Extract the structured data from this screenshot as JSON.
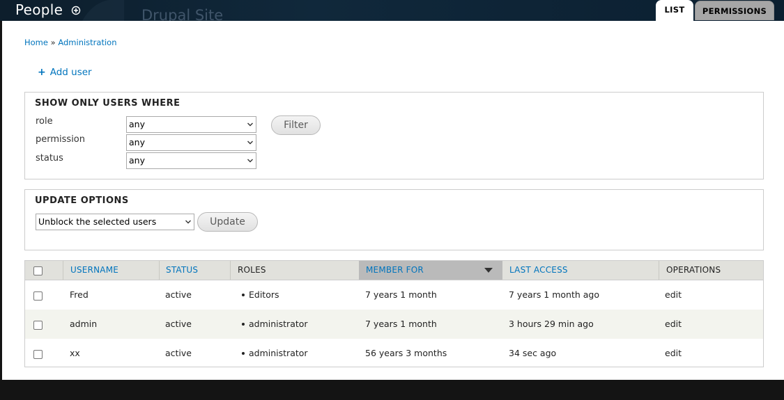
{
  "header": {
    "title": "People",
    "site_name": "Drupal Site",
    "tabs": [
      {
        "label": "LIST",
        "active": true
      },
      {
        "label": "PERMISSIONS",
        "active": false
      }
    ]
  },
  "breadcrumb": {
    "items": [
      "Home",
      "Administration"
    ],
    "separator": "»"
  },
  "actions": {
    "add_user": "Add user"
  },
  "filter": {
    "legend": "SHOW ONLY USERS WHERE",
    "fields": [
      {
        "label": "role",
        "value": "any"
      },
      {
        "label": "permission",
        "value": "any"
      },
      {
        "label": "status",
        "value": "any"
      }
    ],
    "button": "Filter"
  },
  "update": {
    "legend": "UPDATE OPTIONS",
    "selected": "Unblock the selected users",
    "button": "Update"
  },
  "table": {
    "columns": [
      "USERNAME",
      "STATUS",
      "ROLES",
      "MEMBER FOR",
      "LAST ACCESS",
      "OPERATIONS"
    ],
    "sorted_column": "MEMBER FOR",
    "rows": [
      {
        "username": "Fred",
        "status": "active",
        "role": "Editors",
        "member_for": "7 years 1 month",
        "last_access": "7 years 1 month ago",
        "op": "edit"
      },
      {
        "username": "admin",
        "status": "active",
        "role": "administrator",
        "member_for": "7 years 1 month",
        "last_access": "3 hours 29 min ago",
        "op": "edit"
      },
      {
        "username": "xx",
        "status": "active",
        "role": "administrator",
        "member_for": "56 years 3 months",
        "last_access": "34 sec ago",
        "op": "edit"
      }
    ]
  },
  "colors": {
    "link": "#0074bd",
    "header_bg": "#0d1e2c",
    "table_header": "#e1e1dc",
    "sorted_header": "#bababa"
  }
}
